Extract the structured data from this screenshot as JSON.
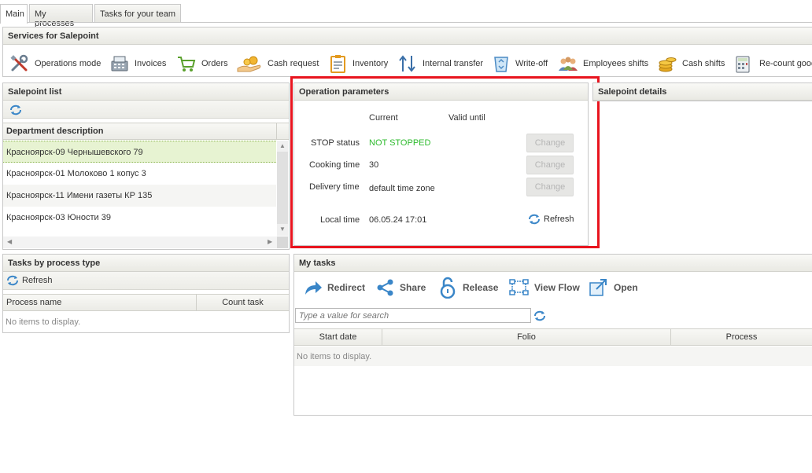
{
  "tabs": [
    "Main",
    "My processes",
    "Tasks for your team"
  ],
  "services": {
    "title": "Services for Salepoint",
    "items": [
      {
        "label": "Operations mode",
        "icon": "tools-icon"
      },
      {
        "label": "Invoices",
        "icon": "cash-register-icon"
      },
      {
        "label": "Orders",
        "icon": "cart-icon"
      },
      {
        "label": "Cash request",
        "icon": "coins-hand-icon"
      },
      {
        "label": "Inventory",
        "icon": "clipboard-icon"
      },
      {
        "label": "Internal transfer",
        "icon": "transfer-arrows-icon"
      },
      {
        "label": "Write-off",
        "icon": "recycle-bin-icon"
      },
      {
        "label": "Employees shifts",
        "icon": "people-icon"
      },
      {
        "label": "Cash shifts",
        "icon": "coin-stack-icon"
      },
      {
        "label": "Re-count goods",
        "icon": "calculator-icon"
      }
    ]
  },
  "salepoint_list": {
    "title": "Salepoint list",
    "column": "Department description",
    "rows": [
      "Красноярск-09 Чернышевского 79",
      "Красноярск-01 Молоково 1 копус 3",
      "Красноярск-11 Имени газеты КР 135",
      "Красноярск-03 Юности 39"
    ],
    "selected_index": 0
  },
  "operation_parameters": {
    "title": "Operation parameters",
    "col_current": "Current",
    "col_valid_until": "Valid until",
    "stop_label": "STOP status",
    "stop_value": "NOT STOPPED",
    "cooking_label": "Cooking time",
    "cooking_value": "30",
    "delivery_label": "Delivery time",
    "delivery_value": "default time zone",
    "local_label": "Local time",
    "local_value": "06.05.24 17:01",
    "change_label": "Change",
    "refresh_label": "Refresh"
  },
  "salepoint_details": {
    "title": "Salepoint details"
  },
  "tasks_by_type": {
    "title": "Tasks by process type",
    "refresh_label": "Refresh",
    "col_process": "Process name",
    "col_count": "Count task",
    "empty": "No items to display."
  },
  "my_tasks": {
    "title": "My tasks",
    "buttons": [
      "Redirect",
      "Share",
      "Release",
      "View Flow",
      "Open"
    ],
    "search_placeholder": "Type a value for search",
    "col_start": "Start date",
    "col_folio": "Folio",
    "col_process": "Process",
    "empty": "No items to display."
  },
  "colors": {
    "highlight_box": "#e8141e",
    "stop_ok": "#2dbb2d",
    "accent_blue": "#3a86c8",
    "selected_row": "#e7f3d2"
  }
}
